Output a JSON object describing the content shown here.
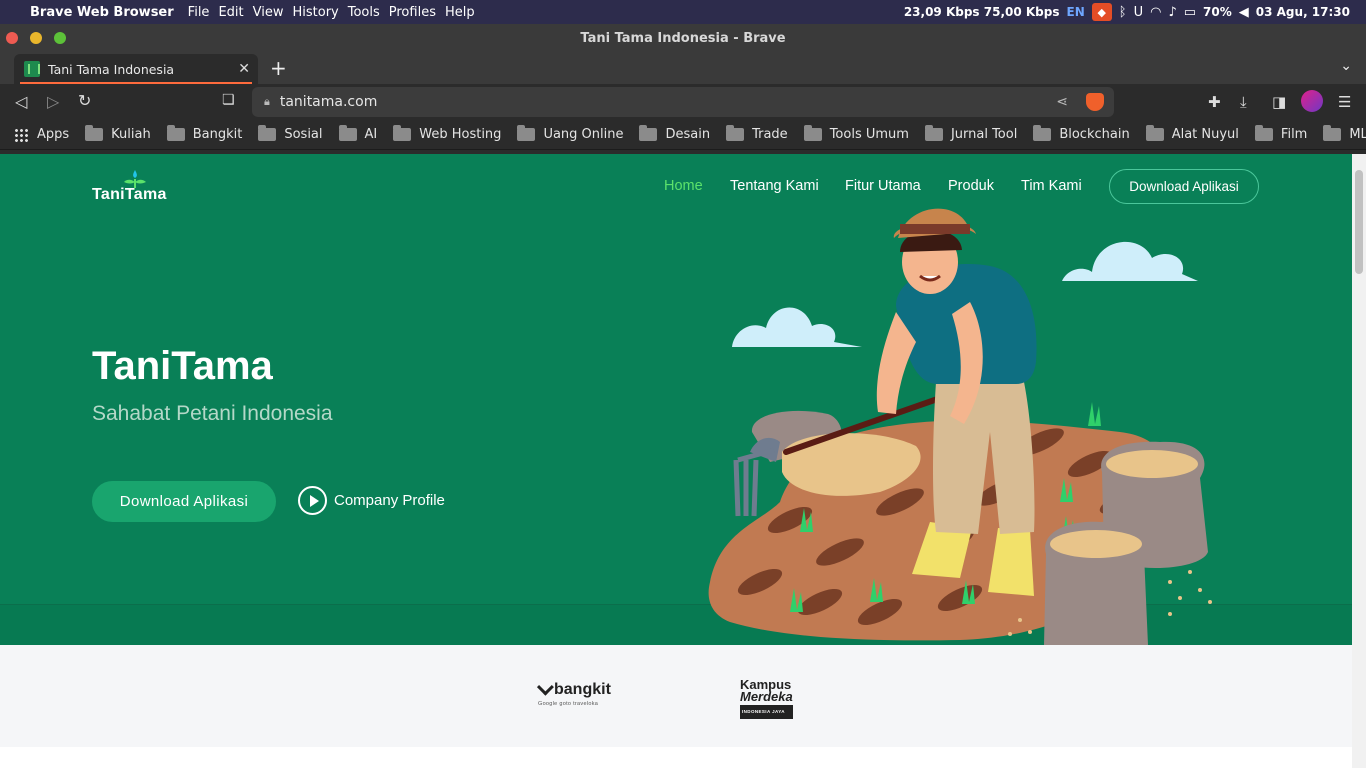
{
  "menubar": {
    "app_name": "Brave Web Browser",
    "menus": [
      "File",
      "Edit",
      "View",
      "History",
      "Tools",
      "Profiles",
      "Help"
    ],
    "network": "23,09 Kbps 75,00 Kbps",
    "input_lang": "EN",
    "battery": "70%",
    "clock": "03 Agu, 17:30"
  },
  "window": {
    "title": "Tani Tama Indonesia - Brave"
  },
  "tabs": [
    {
      "title": "Tani Tama Indonesia",
      "active": true
    }
  ],
  "toolbar": {
    "url": "tanitama.com"
  },
  "bookmarks": {
    "apps_label": "Apps",
    "folders": [
      "Kuliah",
      "Bangkit",
      "Sosial",
      "AI",
      "Web Hosting",
      "Uang Online",
      "Desain",
      "Trade",
      "Tools Umum",
      "Jurnal Tool",
      "Blockchain",
      "Alat Nuyul",
      "Film",
      "ML"
    ]
  },
  "site": {
    "logo_text": "TaniTama",
    "nav": [
      {
        "label": "Home",
        "active": true
      },
      {
        "label": "Tentang Kami",
        "active": false
      },
      {
        "label": "Fitur Utama",
        "active": false
      },
      {
        "label": "Produk",
        "active": false
      },
      {
        "label": "Tim Kami",
        "active": false
      }
    ],
    "nav_cta": "Download Aplikasi",
    "hero": {
      "title": "TaniTama",
      "subtitle": "Sahabat Petani Indonesia",
      "primary_cta": "Download Aplikasi",
      "secondary_cta": "Company Profile"
    },
    "partners": {
      "bangkit_name": "bangkit",
      "bangkit_sub": "Google  goto  traveloka",
      "kampus_line1": "Kampus",
      "kampus_line2": "Merdeka",
      "kampus_tag": "INDONESIA JAYA"
    }
  },
  "colors": {
    "hero_bg": "#098057",
    "nav_active": "#5be26b",
    "cta_bg": "#19a56e",
    "menubar_bg": "#2d2c4c"
  }
}
